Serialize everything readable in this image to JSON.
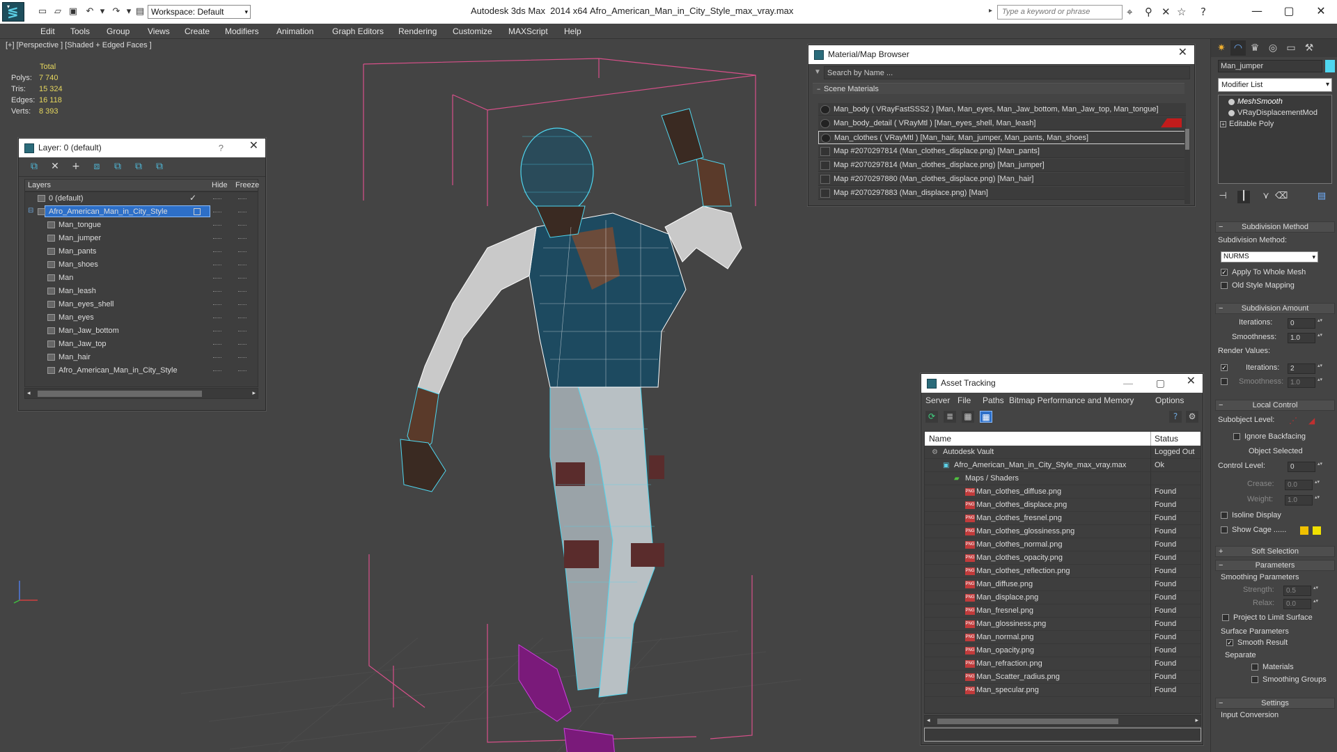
{
  "title_bar": {
    "app_title": "Autodesk 3ds Max  2014 x64",
    "file_name": "Afro_American_Man_in_City_Style_max_vray.max",
    "workspace": "Workspace: Default",
    "search_placeholder": "Type a keyword or phrase",
    "window_controls": [
      "minimize",
      "maximize",
      "close"
    ]
  },
  "menu": [
    "Edit",
    "Tools",
    "Group",
    "Views",
    "Create",
    "Modifiers",
    "Animation",
    "Graph Editors",
    "Rendering",
    "Customize",
    "MAXScript",
    "Help"
  ],
  "viewport": {
    "label": "[+] [Perspective ] [Shaded + Edged Faces ]",
    "stats": {
      "total_label": "Total",
      "rows": [
        {
          "label": "Polys:",
          "value": "7 740"
        },
        {
          "label": "Tris:",
          "value": "15 324"
        },
        {
          "label": "Edges:",
          "value": "16 118"
        },
        {
          "label": "Verts:",
          "value": "8 393"
        }
      ]
    },
    "colors": {
      "wire": "#4fd6ef",
      "bbox": "#e0508a",
      "shoes": "#b020c0"
    }
  },
  "layer_panel": {
    "title": "Layer: 0 (default)",
    "help": "?",
    "columns": {
      "layers": "Layers",
      "hide": "Hide",
      "freeze": "Freeze"
    },
    "rows": [
      {
        "name": "0 (default)",
        "level": 0,
        "checked": true
      },
      {
        "name": "Afro_American_Man_in_City_Style",
        "level": 0,
        "selected": true
      },
      {
        "name": "Man_tongue",
        "level": 1
      },
      {
        "name": "Man_jumper",
        "level": 1
      },
      {
        "name": "Man_pants",
        "level": 1
      },
      {
        "name": "Man_shoes",
        "level": 1
      },
      {
        "name": "Man",
        "level": 1
      },
      {
        "name": "Man_leash",
        "level": 1
      },
      {
        "name": "Man_eyes_shell",
        "level": 1
      },
      {
        "name": "Man_eyes",
        "level": 1
      },
      {
        "name": "Man_Jaw_bottom",
        "level": 1
      },
      {
        "name": "Man_Jaw_top",
        "level": 1
      },
      {
        "name": "Man_hair",
        "level": 1
      },
      {
        "name": "Afro_American_Man_in_City_Style",
        "level": 1
      }
    ]
  },
  "material_browser": {
    "title": "Material/Map Browser",
    "search_placeholder": "Search by Name ...",
    "section": "Scene Materials",
    "rows": [
      {
        "text": "Man_body  ( VRayFastSSS2 ) [Man, Man_eyes, Man_Jaw_bottom, Man_Jaw_top, Man_tongue]",
        "kind": "mtl"
      },
      {
        "text": "Man_body_detail  ( VRayMtl ) [Man_eyes_shell, Man_leash]",
        "kind": "mtl"
      },
      {
        "text": "Man_clothes  ( VRayMtl ) [Man_hair, Man_jumper, Man_pants, Man_shoes]",
        "kind": "mtl",
        "selected": true
      },
      {
        "text": "Map #2070297814 (Man_clothes_displace.png) [Man_pants]",
        "kind": "map"
      },
      {
        "text": "Map #2070297814 (Man_clothes_displace.png) [Man_jumper]",
        "kind": "map"
      },
      {
        "text": "Map #2070297880 (Man_clothes_displace.png) [Man_hair]",
        "kind": "map"
      },
      {
        "text": "Map #2070297883 (Man_displace.png) [Man]",
        "kind": "map"
      }
    ]
  },
  "asset_tracking": {
    "title": "Asset Tracking",
    "menu": [
      "Server",
      "File",
      "Paths",
      "Bitmap Performance and Memory",
      "Options"
    ],
    "columns": {
      "name": "Name",
      "status": "Status"
    },
    "rows": [
      {
        "name": "Autodesk Vault",
        "status": "Logged Out",
        "indent": 0,
        "icon": "vault"
      },
      {
        "name": "Afro_American_Man_in_City_Style_max_vray.max",
        "status": "Ok",
        "indent": 1,
        "icon": "max"
      },
      {
        "name": "Maps / Shaders",
        "status": "",
        "indent": 2,
        "icon": "folder"
      },
      {
        "name": "Man_clothes_diffuse.png",
        "status": "Found",
        "indent": 3,
        "icon": "png"
      },
      {
        "name": "Man_clothes_displace.png",
        "status": "Found",
        "indent": 3,
        "icon": "png"
      },
      {
        "name": "Man_clothes_fresnel.png",
        "status": "Found",
        "indent": 3,
        "icon": "png"
      },
      {
        "name": "Man_clothes_glossiness.png",
        "status": "Found",
        "indent": 3,
        "icon": "png"
      },
      {
        "name": "Man_clothes_normal.png",
        "status": "Found",
        "indent": 3,
        "icon": "png"
      },
      {
        "name": "Man_clothes_opacity.png",
        "status": "Found",
        "indent": 3,
        "icon": "png"
      },
      {
        "name": "Man_clothes_reflection.png",
        "status": "Found",
        "indent": 3,
        "icon": "png"
      },
      {
        "name": "Man_diffuse.png",
        "status": "Found",
        "indent": 3,
        "icon": "png"
      },
      {
        "name": "Man_displace.png",
        "status": "Found",
        "indent": 3,
        "icon": "png"
      },
      {
        "name": "Man_fresnel.png",
        "status": "Found",
        "indent": 3,
        "icon": "png"
      },
      {
        "name": "Man_glossiness.png",
        "status": "Found",
        "indent": 3,
        "icon": "png"
      },
      {
        "name": "Man_normal.png",
        "status": "Found",
        "indent": 3,
        "icon": "png"
      },
      {
        "name": "Man_opacity.png",
        "status": "Found",
        "indent": 3,
        "icon": "png"
      },
      {
        "name": "Man_refraction.png",
        "status": "Found",
        "indent": 3,
        "icon": "png"
      },
      {
        "name": "Man_Scatter_radius.png",
        "status": "Found",
        "indent": 3,
        "icon": "png"
      },
      {
        "name": "Man_specular.png",
        "status": "Found",
        "indent": 3,
        "icon": "png"
      }
    ]
  },
  "command_panel": {
    "object_name": "Man_jumper",
    "modifier_list": "Modifier List",
    "stack": [
      "MeshSmooth",
      "VRayDisplacementMod",
      "Editable Poly"
    ],
    "rollouts": {
      "subdivision_method": "Subdivision Method",
      "subdivision_method_label": "Subdivision Method:",
      "method_value": "NURMS",
      "apply_whole_mesh": "Apply To Whole Mesh",
      "old_style_mapping": "Old Style Mapping",
      "subdivision_amount": "Subdivision Amount",
      "iterations_label": "Iterations:",
      "iterations_value": "0",
      "smoothness_label": "Smoothness:",
      "smoothness_value": "1.0",
      "render_values": "Render Values:",
      "render_iterations_label": "Iterations:",
      "render_iterations_value": "2",
      "render_smoothness_label": "Smoothness:",
      "render_smoothness_value": "1.0",
      "local_control": "Local Control",
      "subobject_level": "Subobject Level:",
      "ignore_backfacing": "Ignore Backfacing",
      "object_selected": "Object Selected",
      "control_level_label": "Control Level:",
      "control_level_value": "0",
      "crease_label": "Crease:",
      "crease_value": "0.0",
      "weight_label": "Weight:",
      "weight_value": "1.0",
      "isoline_display": "Isoline Display",
      "show_cage": "Show Cage ......",
      "soft_selection": "Soft Selection",
      "parameters": "Parameters",
      "smoothing_parameters": "Smoothing Parameters",
      "strength_label": "Strength:",
      "strength_value": "0.5",
      "relax_label": "Relax:",
      "relax_value": "0.0",
      "project_limit": "Project to Limit Surface",
      "surface_parameters": "Surface Parameters",
      "smooth_result": "Smooth Result",
      "separate": "Separate",
      "materials": "Materials",
      "smoothing_groups": "Smoothing Groups",
      "settings": "Settings",
      "input_conversion": "Input Conversion"
    },
    "cage_colors": [
      "#f0c000",
      "#f0e000"
    ]
  }
}
